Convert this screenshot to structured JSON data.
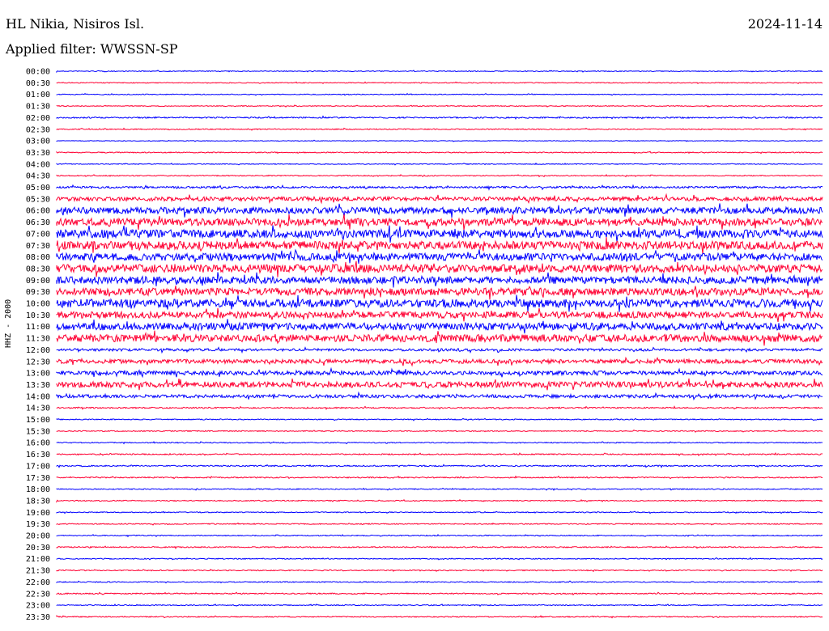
{
  "header": {
    "station": "HL Nikia, Nisiros Isl.",
    "date": "2024-11-14",
    "filter": "Applied filter: WWSSN-SP",
    "channel": "HHZ - 2000"
  },
  "chart_data": {
    "type": "line",
    "title": "HL Nikia, Nisiros Isl.",
    "date": "2024-11-14",
    "ylabel": "HHZ - 2000",
    "colors": [
      "#0000ff",
      "#ff0033"
    ],
    "times": [
      "00:00",
      "00:30",
      "01:00",
      "01:30",
      "02:00",
      "02:30",
      "03:00",
      "03:30",
      "04:00",
      "04:30",
      "05:00",
      "05:30",
      "06:00",
      "06:30",
      "07:00",
      "07:30",
      "08:00",
      "08:30",
      "09:00",
      "09:30",
      "10:00",
      "10:30",
      "11:00",
      "11:30",
      "12:00",
      "12:30",
      "13:00",
      "13:30",
      "14:00",
      "14:30",
      "15:00",
      "15:30",
      "16:00",
      "16:30",
      "17:00",
      "17:30",
      "18:00",
      "18:30",
      "19:00",
      "19:30",
      "20:00",
      "20:30",
      "21:00",
      "21:30",
      "22:00",
      "22:30",
      "23:00",
      "23:30"
    ],
    "activity": [
      0.5,
      0.5,
      0.5,
      0.5,
      0.8,
      0.6,
      0.4,
      0.6,
      0.5,
      0.6,
      1.2,
      2.5,
      4,
      4.5,
      5,
      5,
      4.5,
      5,
      4.5,
      4.5,
      5,
      4,
      4.5,
      4.5,
      1.5,
      2.5,
      2.5,
      3.5,
      2,
      0.8,
      0.6,
      0.6,
      0.6,
      0.7,
      0.8,
      0.7,
      0.6,
      0.6,
      0.6,
      0.6,
      0.6,
      0.7,
      0.6,
      0.6,
      0.6,
      0.7,
      0.6,
      0.6
    ]
  }
}
